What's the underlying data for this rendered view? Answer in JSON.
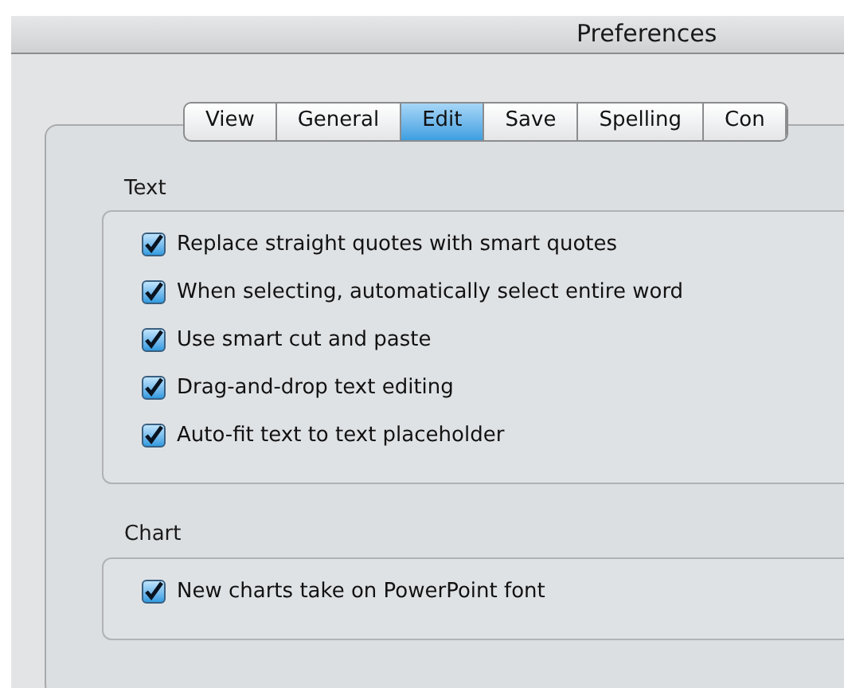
{
  "window": {
    "title": "Preferences"
  },
  "tabs": [
    {
      "label": "View",
      "selected": false
    },
    {
      "label": "General",
      "selected": false
    },
    {
      "label": "Edit",
      "selected": true
    },
    {
      "label": "Save",
      "selected": false
    },
    {
      "label": "Spelling",
      "selected": false
    },
    {
      "label": "Con",
      "selected": false
    }
  ],
  "groups": [
    {
      "title": "Text",
      "options": [
        {
          "label": "Replace straight quotes with smart quotes",
          "checked": true
        },
        {
          "label": "When selecting, automatically select entire word",
          "checked": true
        },
        {
          "label": "Use smart cut and paste",
          "checked": true
        },
        {
          "label": "Drag-and-drop text editing",
          "checked": true
        },
        {
          "label": "Auto-fit text to text placeholder",
          "checked": true
        }
      ]
    },
    {
      "title": "Chart",
      "options": [
        {
          "label": "New charts take on PowerPoint font",
          "checked": true
        }
      ]
    }
  ]
}
